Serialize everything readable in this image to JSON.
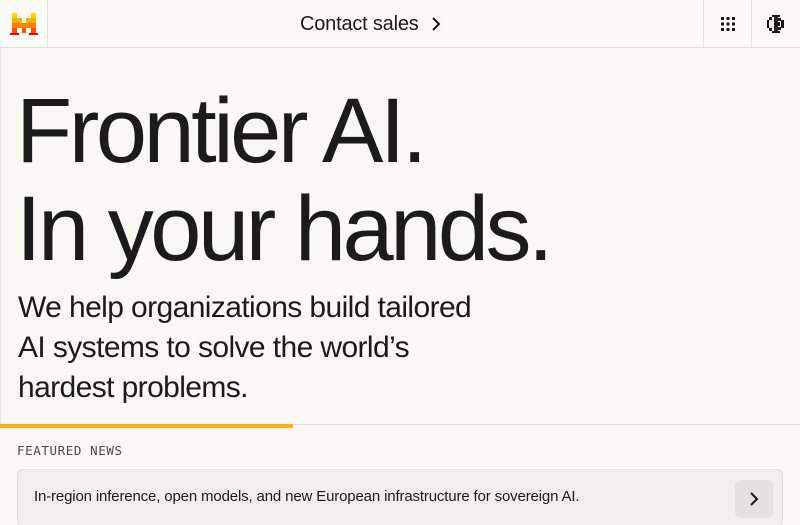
{
  "header": {
    "logo_name": "mistral-logo",
    "contact_label": "Contact sales",
    "contact_icon": "chevron-right-icon",
    "apps_icon": "grid-icon",
    "theme_icon": "theme-toggle-icon"
  },
  "hero": {
    "headline_line1": "Frontier AI.",
    "headline_line2": "In your hands.",
    "subheadline": "We help organizations build tailored AI systems to solve the world’s hardest problems."
  },
  "carousel": {
    "progress_fraction": 0.366
  },
  "featured": {
    "label": "FEATURED NEWS",
    "news_item": "In-region inference, open models, and new European infrastructure for sovereign AI.",
    "news_icon": "chevron-right-icon"
  },
  "colors": {
    "accent": "#f6b21e",
    "background": "#f9f8f4",
    "text": "#1b1b1b",
    "logo_orange": "#fa500f",
    "logo_yellow": "#ffd800"
  }
}
